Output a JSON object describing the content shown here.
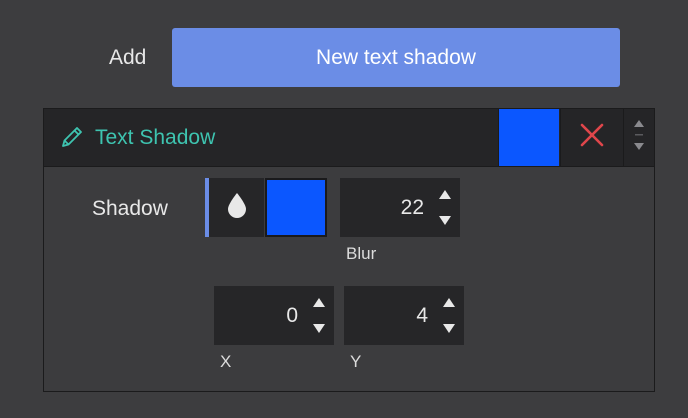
{
  "add_row": {
    "label": "Add",
    "button_label": "New text shadow"
  },
  "panel": {
    "title": "Text Shadow",
    "title_icon": "pencil-icon",
    "header_color": "#0b57ff",
    "delete_icon": "close-icon",
    "sort_icon": "sort-handle-icon"
  },
  "shadow": {
    "label": "Shadow",
    "mode_icon": "drop-icon",
    "color": "#0b57ff",
    "blur": {
      "value": "22",
      "caption": "Blur"
    },
    "x": {
      "value": "0",
      "caption": "X"
    },
    "y": {
      "value": "4",
      "caption": "Y"
    }
  },
  "colors": {
    "accent": "#6b8de6",
    "title_teal": "#3ec4b0",
    "delete_red": "#e0464b",
    "background": "#3d3d3f",
    "field_bg": "#262628"
  }
}
